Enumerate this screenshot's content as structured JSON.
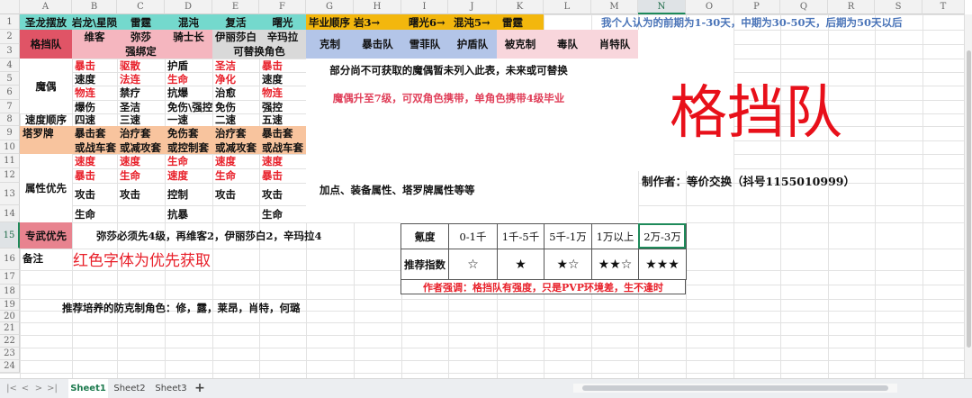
{
  "columns": [
    "A",
    "B",
    "C",
    "D",
    "E",
    "F",
    "G",
    "H",
    "I",
    "J",
    "K",
    "L",
    "M",
    "N",
    "O",
    "P",
    "Q",
    "R",
    "S",
    "T"
  ],
  "rows": [
    "1",
    "2",
    "3",
    "4",
    "5",
    "6",
    "7",
    "8",
    "9",
    "10",
    "11",
    "12",
    "13",
    "14",
    "15",
    "16",
    "17",
    "18",
    "19",
    "20",
    "21",
    "22",
    "23",
    "24"
  ],
  "row1": {
    "a": "圣龙摆放",
    "b": "岩龙\\星陨",
    "c": "雷霆",
    "d": "混沌",
    "e": "复活",
    "f": "曙光",
    "order": "毕业顺序 岩3→",
    "order2": "曙光6→",
    "order3": "混沌5→",
    "order4": "雷霆",
    "note": "我个人认为的前期为1-30天，中期为30-50天，后期为50天以后"
  },
  "team": {
    "name": "格挡队",
    "b": "维客",
    "c1": "弥莎",
    "c2": "强绑定",
    "d": "骑士长",
    "e": "伊丽莎白",
    "f": "辛玛拉",
    "ef": "可替换角色"
  },
  "counter": {
    "label": "克制",
    "items": [
      "暴击队",
      "雪菲队",
      "护盾队"
    ],
    "countered_label": "被克制",
    "countered": [
      "毒队",
      "肖特队"
    ]
  },
  "puppet": {
    "label": "魔偶",
    "b": [
      "暴击",
      "速度",
      "物连",
      "爆伤"
    ],
    "c": [
      "驱散",
      "法连",
      "禁疗",
      "圣洁"
    ],
    "d": [
      "护盾",
      "生命",
      "抗爆",
      "免伤\\强控"
    ],
    "e": [
      "圣洁",
      "净化",
      "治愈",
      "免伤"
    ],
    "f": [
      "暴击",
      "速度",
      "物连",
      "强控"
    ]
  },
  "speed": {
    "label": "速度顺序",
    "values": [
      "四速",
      "三速",
      "一速",
      "二速",
      "五速"
    ]
  },
  "tarot": {
    "label": "塔罗牌",
    "l1": [
      "暴击套",
      "治疗套",
      "免伤套",
      "治疗套",
      "暴击套"
    ],
    "l2": [
      "或战车套",
      "或减攻套",
      "或控制套",
      "或减攻套",
      "或战车套"
    ]
  },
  "attr": {
    "label": "属性优先",
    "b": [
      "速度",
      "暴击",
      "攻击",
      "生命"
    ],
    "c": [
      "速度",
      "生命",
      "攻击",
      ""
    ],
    "d": [
      "生命",
      "速度",
      "控制",
      "抗暴"
    ],
    "e": [
      "速度",
      "生命",
      "攻击",
      ""
    ],
    "f": [
      "速度",
      "暴击",
      "攻击",
      "生命"
    ]
  },
  "notes": {
    "puppet_missing": "部分尚不可获取的魔偶暂未列入此表，未来或可替换",
    "puppet_level": "魔偶升至7级，可双角色携带，单角色携带4级毕业",
    "extra": "加点、装备属性、塔罗牌属性等等",
    "big_title": "格挡队",
    "author": "制作者：等价交换（抖号1155010999）",
    "weapon_label": "专武优先",
    "weapon": "弥莎必须先4级，再维客2，伊丽莎白2，辛玛拉4",
    "remark_label": "备注",
    "remark": "红色字体为优先获取",
    "recommend": "推荐培养的防克制角色：修，露，莱昂，肖特，何璐"
  },
  "krypton": {
    "header": "氪度",
    "ranges": [
      "0-1千",
      "1千-5千",
      "5千-1万",
      "1万以上",
      "2万-3万"
    ],
    "index_label": "推荐指数",
    "stars": [
      "☆",
      "★",
      "★☆",
      "★★☆",
      "★★★"
    ],
    "emphasis": "作者强调：格挡队有强度，只是PVP环境差，生不逢时"
  },
  "tabs": {
    "nav": [
      "|<",
      "<",
      ">",
      ">|"
    ],
    "sheets": [
      "Sheet1",
      "Sheet2",
      "Sheet3"
    ],
    "add": "+"
  }
}
